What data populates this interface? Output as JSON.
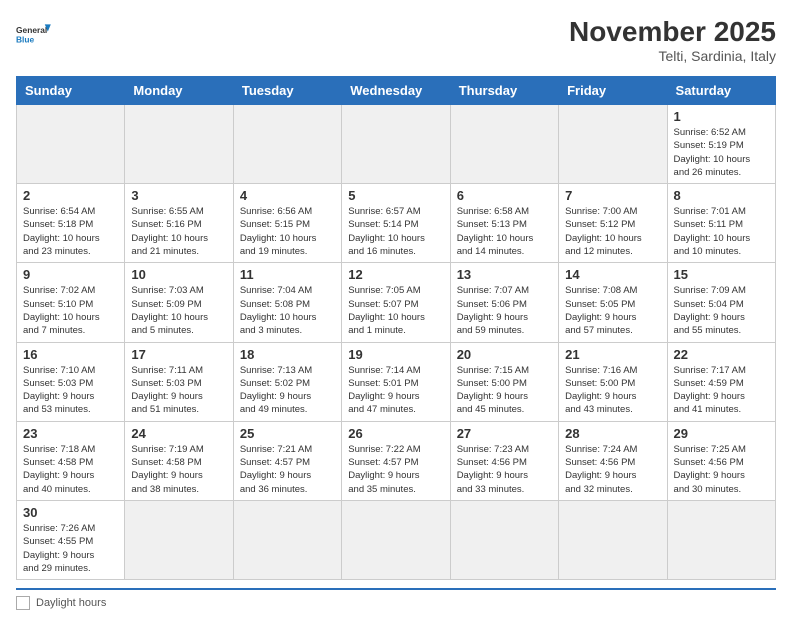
{
  "header": {
    "logo_general": "General",
    "logo_blue": "Blue",
    "month_title": "November 2025",
    "location": "Telti, Sardinia, Italy"
  },
  "weekdays": [
    "Sunday",
    "Monday",
    "Tuesday",
    "Wednesday",
    "Thursday",
    "Friday",
    "Saturday"
  ],
  "weeks": [
    [
      {
        "day": "",
        "info": ""
      },
      {
        "day": "",
        "info": ""
      },
      {
        "day": "",
        "info": ""
      },
      {
        "day": "",
        "info": ""
      },
      {
        "day": "",
        "info": ""
      },
      {
        "day": "",
        "info": ""
      },
      {
        "day": "1",
        "info": "Sunrise: 6:52 AM\nSunset: 5:19 PM\nDaylight: 10 hours\nand 26 minutes."
      }
    ],
    [
      {
        "day": "2",
        "info": "Sunrise: 6:54 AM\nSunset: 5:18 PM\nDaylight: 10 hours\nand 23 minutes."
      },
      {
        "day": "3",
        "info": "Sunrise: 6:55 AM\nSunset: 5:16 PM\nDaylight: 10 hours\nand 21 minutes."
      },
      {
        "day": "4",
        "info": "Sunrise: 6:56 AM\nSunset: 5:15 PM\nDaylight: 10 hours\nand 19 minutes."
      },
      {
        "day": "5",
        "info": "Sunrise: 6:57 AM\nSunset: 5:14 PM\nDaylight: 10 hours\nand 16 minutes."
      },
      {
        "day": "6",
        "info": "Sunrise: 6:58 AM\nSunset: 5:13 PM\nDaylight: 10 hours\nand 14 minutes."
      },
      {
        "day": "7",
        "info": "Sunrise: 7:00 AM\nSunset: 5:12 PM\nDaylight: 10 hours\nand 12 minutes."
      },
      {
        "day": "8",
        "info": "Sunrise: 7:01 AM\nSunset: 5:11 PM\nDaylight: 10 hours\nand 10 minutes."
      }
    ],
    [
      {
        "day": "9",
        "info": "Sunrise: 7:02 AM\nSunset: 5:10 PM\nDaylight: 10 hours\nand 7 minutes."
      },
      {
        "day": "10",
        "info": "Sunrise: 7:03 AM\nSunset: 5:09 PM\nDaylight: 10 hours\nand 5 minutes."
      },
      {
        "day": "11",
        "info": "Sunrise: 7:04 AM\nSunset: 5:08 PM\nDaylight: 10 hours\nand 3 minutes."
      },
      {
        "day": "12",
        "info": "Sunrise: 7:05 AM\nSunset: 5:07 PM\nDaylight: 10 hours\nand 1 minute."
      },
      {
        "day": "13",
        "info": "Sunrise: 7:07 AM\nSunset: 5:06 PM\nDaylight: 9 hours\nand 59 minutes."
      },
      {
        "day": "14",
        "info": "Sunrise: 7:08 AM\nSunset: 5:05 PM\nDaylight: 9 hours\nand 57 minutes."
      },
      {
        "day": "15",
        "info": "Sunrise: 7:09 AM\nSunset: 5:04 PM\nDaylight: 9 hours\nand 55 minutes."
      }
    ],
    [
      {
        "day": "16",
        "info": "Sunrise: 7:10 AM\nSunset: 5:03 PM\nDaylight: 9 hours\nand 53 minutes."
      },
      {
        "day": "17",
        "info": "Sunrise: 7:11 AM\nSunset: 5:03 PM\nDaylight: 9 hours\nand 51 minutes."
      },
      {
        "day": "18",
        "info": "Sunrise: 7:13 AM\nSunset: 5:02 PM\nDaylight: 9 hours\nand 49 minutes."
      },
      {
        "day": "19",
        "info": "Sunrise: 7:14 AM\nSunset: 5:01 PM\nDaylight: 9 hours\nand 47 minutes."
      },
      {
        "day": "20",
        "info": "Sunrise: 7:15 AM\nSunset: 5:00 PM\nDaylight: 9 hours\nand 45 minutes."
      },
      {
        "day": "21",
        "info": "Sunrise: 7:16 AM\nSunset: 5:00 PM\nDaylight: 9 hours\nand 43 minutes."
      },
      {
        "day": "22",
        "info": "Sunrise: 7:17 AM\nSunset: 4:59 PM\nDaylight: 9 hours\nand 41 minutes."
      }
    ],
    [
      {
        "day": "23",
        "info": "Sunrise: 7:18 AM\nSunset: 4:58 PM\nDaylight: 9 hours\nand 40 minutes."
      },
      {
        "day": "24",
        "info": "Sunrise: 7:19 AM\nSunset: 4:58 PM\nDaylight: 9 hours\nand 38 minutes."
      },
      {
        "day": "25",
        "info": "Sunrise: 7:21 AM\nSunset: 4:57 PM\nDaylight: 9 hours\nand 36 minutes."
      },
      {
        "day": "26",
        "info": "Sunrise: 7:22 AM\nSunset: 4:57 PM\nDaylight: 9 hours\nand 35 minutes."
      },
      {
        "day": "27",
        "info": "Sunrise: 7:23 AM\nSunset: 4:56 PM\nDaylight: 9 hours\nand 33 minutes."
      },
      {
        "day": "28",
        "info": "Sunrise: 7:24 AM\nSunset: 4:56 PM\nDaylight: 9 hours\nand 32 minutes."
      },
      {
        "day": "29",
        "info": "Sunrise: 7:25 AM\nSunset: 4:56 PM\nDaylight: 9 hours\nand 30 minutes."
      }
    ],
    [
      {
        "day": "30",
        "info": "Sunrise: 7:26 AM\nSunset: 4:55 PM\nDaylight: 9 hours\nand 29 minutes."
      },
      {
        "day": "",
        "info": ""
      },
      {
        "day": "",
        "info": ""
      },
      {
        "day": "",
        "info": ""
      },
      {
        "day": "",
        "info": ""
      },
      {
        "day": "",
        "info": ""
      },
      {
        "day": "",
        "info": ""
      }
    ]
  ],
  "footer": {
    "daylight_label": "Daylight hours"
  }
}
